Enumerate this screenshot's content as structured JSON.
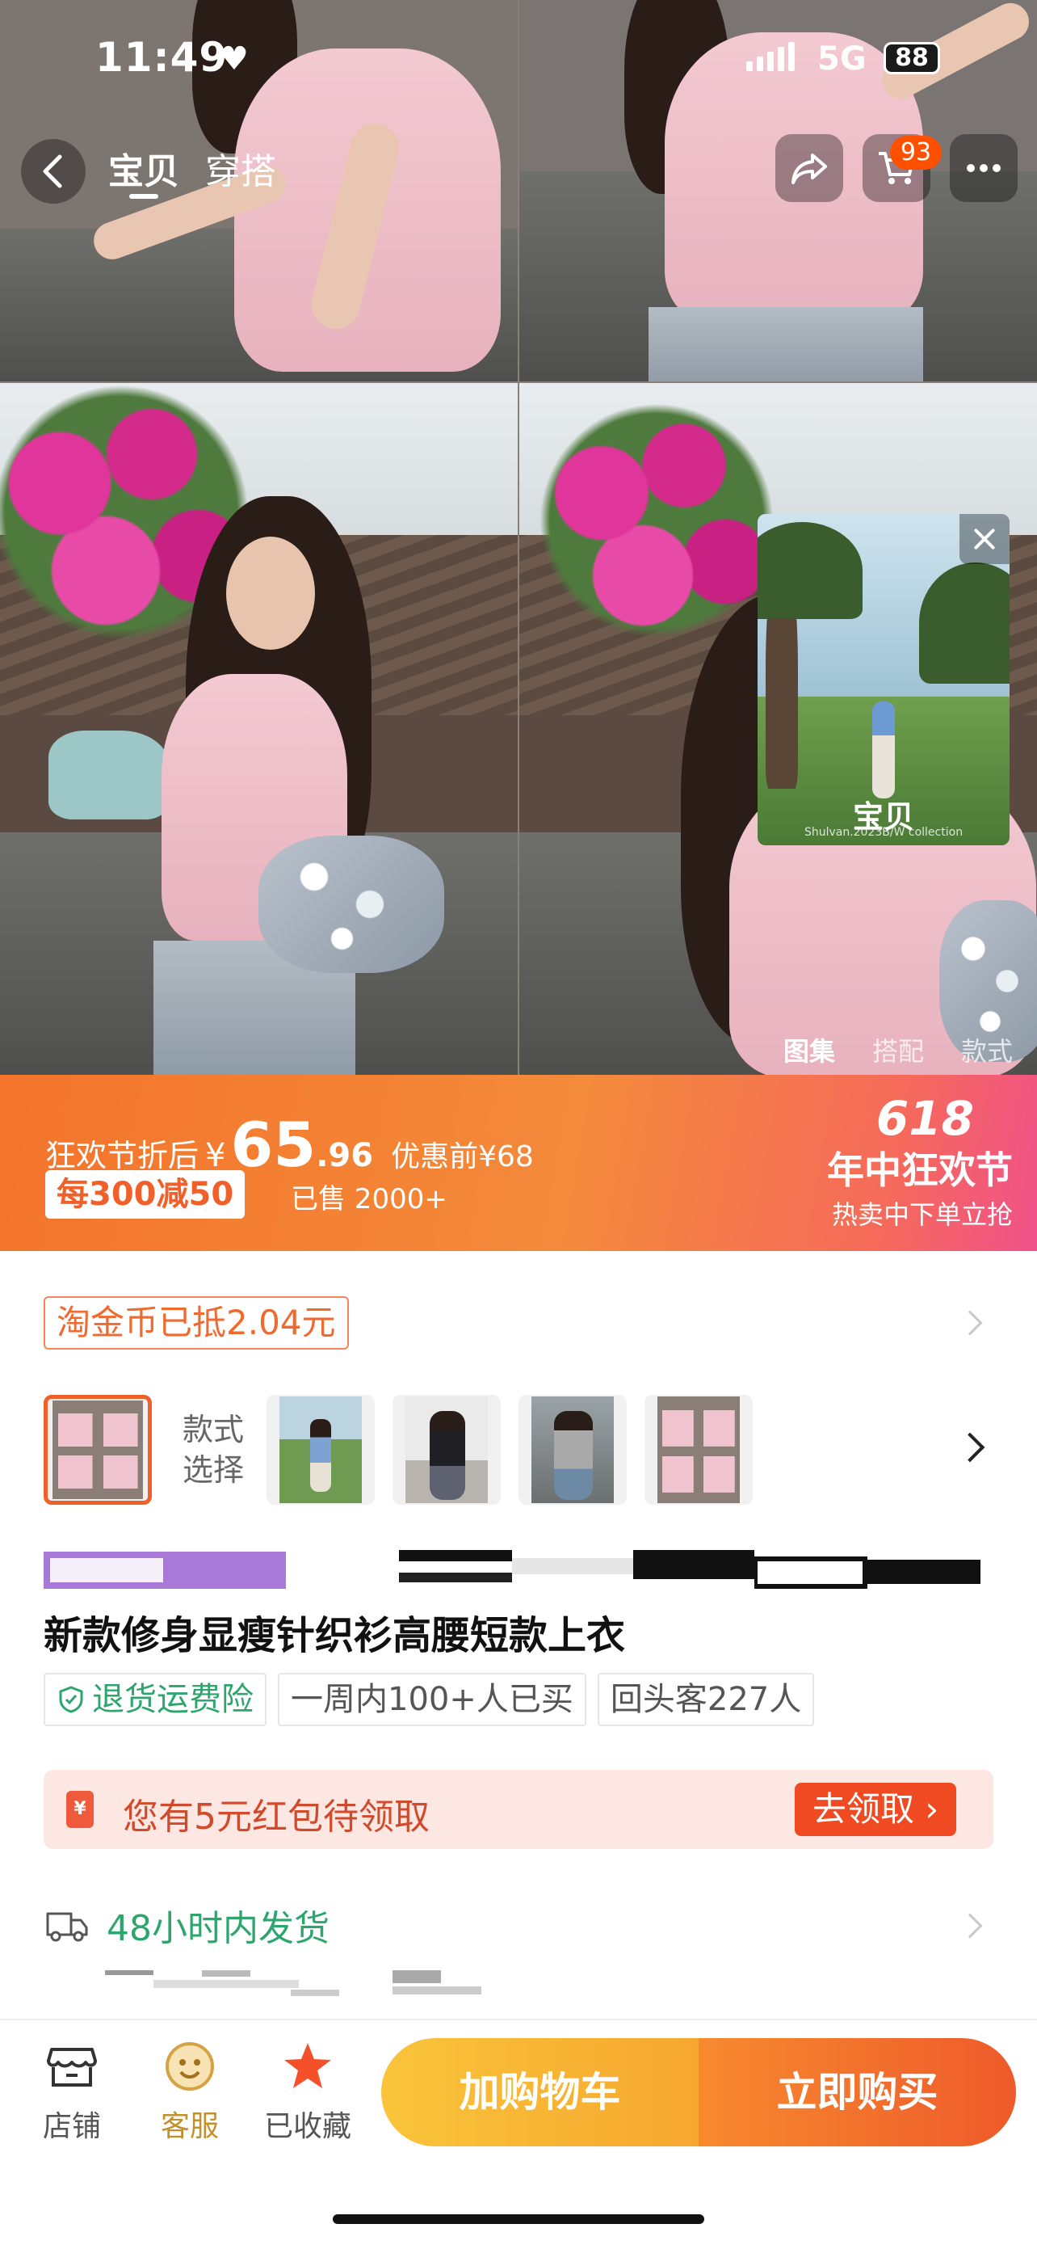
{
  "status_bar": {
    "time": "11:49",
    "network": "5G",
    "battery": "88"
  },
  "nav": {
    "tabs": [
      "宝贝",
      "穿搭"
    ],
    "active_tab": 0,
    "cart_badge": "93"
  },
  "floating_video": {
    "label": "宝贝",
    "caption": "Shulvan.2023B/W collection"
  },
  "gallery_tabs": [
    "图集",
    "搭配",
    "款式"
  ],
  "gallery_active_tab": 0,
  "promo": {
    "price_label": "狂欢节折后",
    "currency": "¥",
    "price_int": "65",
    "price_dec": ".96",
    "original_price": "优惠前¥68",
    "coupon": "每300减50",
    "sold": "已售 2000+",
    "event_number": "618",
    "event_title": "年中狂欢节",
    "event_slogan": "热卖中下单立抢"
  },
  "coins": {
    "text": "淘金币已抵2.04元"
  },
  "style_selector": {
    "label_line1": "款式",
    "label_line2": "选择"
  },
  "product": {
    "title": "新款修身显瘦针织衫高腰短款上衣"
  },
  "tags": [
    {
      "text": "退货运费险",
      "style": "green"
    },
    {
      "text": "一周内100+人已买",
      "style": "normal"
    },
    {
      "text": "回头客227人",
      "style": "normal"
    }
  ],
  "red_packet": {
    "text": "您有5元红包待领取",
    "button": "去领取 ›"
  },
  "shipping": {
    "text": "48小时内发货"
  },
  "bottom_bar": {
    "shop": "店铺",
    "service": "客服",
    "favorite": "已收藏",
    "add_to_cart": "加购物车",
    "buy_now": "立即购买"
  },
  "colors": {
    "accent": "#ff5000",
    "promo_orange": "#f48a3b",
    "green": "#2fa56e",
    "cta_yellow": "#f9c43a",
    "cta_orange": "#ee5a2a"
  }
}
